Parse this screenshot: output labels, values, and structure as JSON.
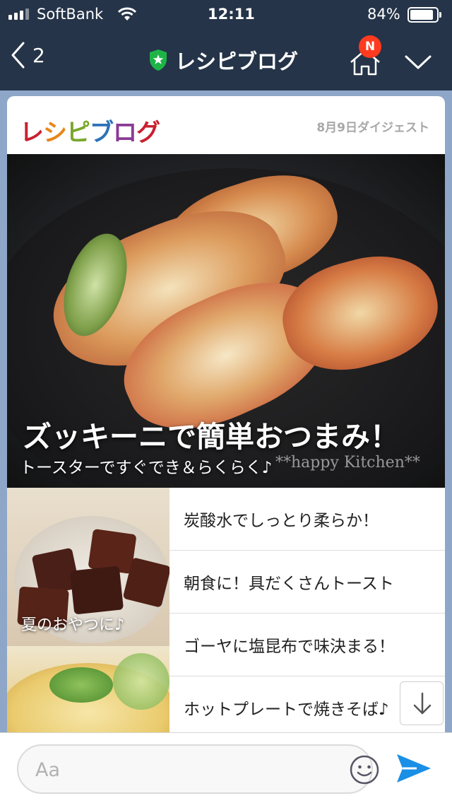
{
  "status": {
    "carrier": "SoftBank",
    "time": "12:11",
    "battery": "84%"
  },
  "header": {
    "back_count": "2",
    "title": "レシピブログ",
    "badge": "N"
  },
  "card": {
    "logo": "レシピブログ",
    "date": "8月9日ダイジェスト",
    "hero_title": "ズッキーニで簡単おつまみ！",
    "hero_subtitle": "トースターですぐでき＆らくらく♪",
    "watermark": "**happy Kitchen**",
    "thumb_caption": "夏のおやつに♪",
    "items": [
      {
        "label": "炭酸水でしっとり柔らか！"
      },
      {
        "label": "朝食に！具だくさんトースト"
      },
      {
        "label": "ゴーヤに塩昆布で味決まる！"
      },
      {
        "label": "ホットプレートで焼きそば♪"
      }
    ]
  },
  "input": {
    "placeholder": "Aa"
  },
  "colors": {
    "header_bg": "#253448",
    "chat_bg": "#8ea6c8",
    "send": "#1a8fe6",
    "badge": "#ff3b1f"
  }
}
